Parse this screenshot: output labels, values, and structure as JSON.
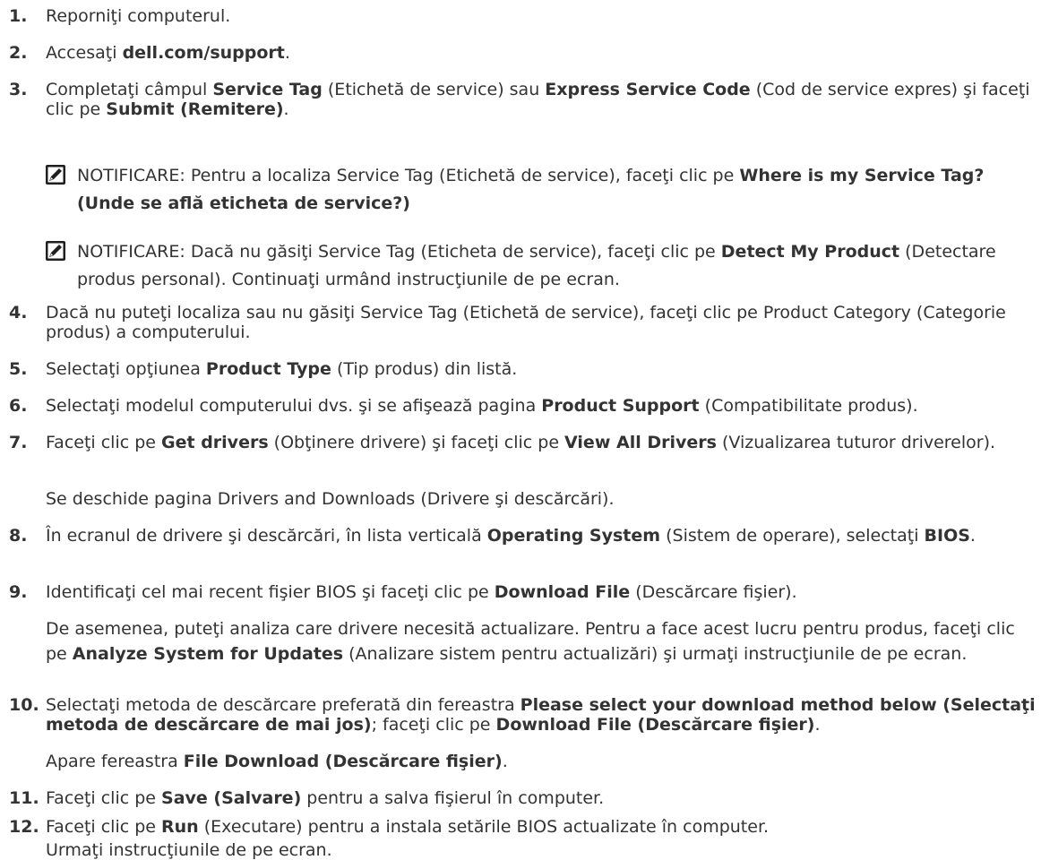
{
  "steps": [
    {
      "num": "1.",
      "segments": [
        [
          "Reporniţi computerul.",
          false
        ]
      ]
    },
    {
      "num": "2.",
      "segments": [
        [
          "Accesaţi ",
          false
        ],
        [
          "dell.com/support",
          true
        ],
        [
          ".",
          false
        ]
      ]
    },
    {
      "num": "3.",
      "segments": [
        [
          "Completaţi câmpul ",
          false
        ],
        [
          "Service Tag",
          true
        ],
        [
          " (Etichetă de service) sau ",
          false
        ],
        [
          "Express Service Code",
          true
        ],
        [
          " (Cod de service expres) şi faceţi clic pe ",
          false
        ],
        [
          "Submit (Remitere)",
          true
        ],
        [
          ".",
          false
        ]
      ]
    },
    {
      "num": "4.",
      "segments": [
        [
          "Dacă nu puteţi localiza sau nu găsiţi Service Tag (Etichetă de service), faceţi clic pe Product Category (Categorie produs) a computerului.",
          false
        ]
      ]
    },
    {
      "num": "5.",
      "segments": [
        [
          "Selectaţi opţiunea ",
          false
        ],
        [
          "Product Type",
          true
        ],
        [
          " (Tip produs) din listă.",
          false
        ]
      ]
    },
    {
      "num": "6.",
      "segments": [
        [
          "Selectaţi modelul computerului dvs. şi se afişează pagina ",
          false
        ],
        [
          "Product Support",
          true
        ],
        [
          " (Compatibilitate produs).",
          false
        ]
      ]
    },
    {
      "num": "7.",
      "segments": [
        [
          "Faceţi clic pe ",
          false
        ],
        [
          "Get drivers",
          true
        ],
        [
          " (Obţinere drivere) şi faceţi clic pe ",
          false
        ],
        [
          "View All Drivers",
          true
        ],
        [
          " (Vizualizarea tuturor driverelor).",
          false
        ]
      ]
    },
    {
      "num": "8.",
      "segments": [
        [
          "În ecranul de drivere şi descărcări, în lista verticală ",
          false
        ],
        [
          "Operating System",
          true
        ],
        [
          " (Sistem de operare), selectaţi ",
          false
        ],
        [
          "BIOS",
          true
        ],
        [
          ".",
          false
        ]
      ]
    },
    {
      "num": "9.",
      "segments": [
        [
          "Identificaţi cel mai recent fişier BIOS şi faceţi clic pe ",
          false
        ],
        [
          "Download File",
          true
        ],
        [
          " (Descărcare fişier).",
          false
        ]
      ]
    },
    {
      "num": "10.",
      "segments": [
        [
          "Selectaţi metoda de descărcare preferată din fereastra ",
          false
        ],
        [
          "Please select your download method below (Selectaţi metoda de descărcare de mai jos)",
          true
        ],
        [
          "; faceţi clic pe ",
          false
        ],
        [
          "Download File (Descărcare fişier)",
          true
        ],
        [
          ".",
          false
        ]
      ]
    },
    {
      "num": "11.",
      "segments": [
        [
          "Faceţi clic pe ",
          false
        ],
        [
          "Save (Salvare)",
          true
        ],
        [
          " pentru a salva fişierul în computer.",
          false
        ]
      ]
    },
    {
      "num": "12.",
      "segments": [
        [
          "Faceţi clic pe ",
          false
        ],
        [
          "Run",
          true
        ],
        [
          " (Executare) pentru a instala setările BIOS actualizate în computer.",
          false
        ]
      ]
    }
  ],
  "continuations": [
    {
      "segments": [
        [
          "Se deschide pagina Drivers and Downloads (Drivere şi descărcări).",
          false
        ]
      ]
    },
    {
      "segments": [
        [
          "De asemenea, puteţi analiza care drivere necesită actualizare. Pentru a face acest lucru pentru produs, faceţi clic pe ",
          false
        ],
        [
          "Analyze System for Updates",
          true
        ],
        [
          " (Analizare sistem pentru actualizări) şi urmaţi instrucţiunile de pe ecran.",
          false
        ]
      ]
    },
    {
      "segments": [
        [
          "Apare fereastra ",
          false
        ],
        [
          "File Download (Descărcare fişier)",
          true
        ],
        [
          ".",
          false
        ]
      ]
    },
    {
      "segments": [
        [
          "Urmaţi instrucţiunile de pe ecran.",
          false
        ]
      ]
    }
  ],
  "notes": [
    {
      "icon": "note-pencil-icon",
      "segments": [
        [
          "NOTIFICARE: ",
          false
        ],
        [
          "Pentru a localiza Service Tag (Etichetă de service), faceţi clic pe ",
          false
        ],
        [
          "Where is my Service Tag? (Unde se află eticheta de service?)",
          true
        ]
      ]
    },
    {
      "icon": "note-pencil-icon",
      "segments": [
        [
          "NOTIFICARE: ",
          false
        ],
        [
          "Dacă nu găsiţi Service Tag (Eticheta de service), faceţi clic pe ",
          false
        ],
        [
          "Detect My Product",
          true
        ],
        [
          " (Detectare produs personal). Continuaţi urmând instrucţiunile de pe ecran.",
          false
        ]
      ]
    }
  ]
}
